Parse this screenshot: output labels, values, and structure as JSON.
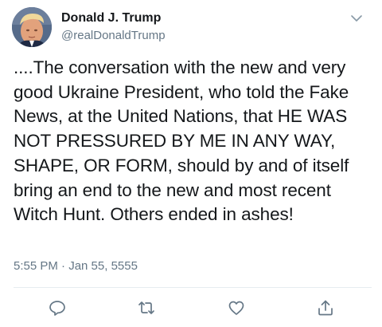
{
  "tweet": {
    "display_name": "Donald J. Trump",
    "handle": "@realDonaldTrump",
    "text": "....The conversation with the new and very good Ukraine President, who told the Fake News, at the United Nations, that HE WAS NOT PRESSURED BY ME IN ANY WAY, SHAPE, OR FORM, should by and of itself bring an end to the new and most recent Witch Hunt. Others ended in ashes!",
    "timestamp": "5:55 PM · Jan 55, 5555"
  },
  "icons": {
    "menu": "chevron-down-icon",
    "reply": "reply-icon",
    "retweet": "retweet-icon",
    "like": "heart-icon",
    "share": "share-icon"
  },
  "colors": {
    "text": "#14171a",
    "secondary": "#657786",
    "icon": "#657786",
    "divider": "#e6ecf0"
  }
}
